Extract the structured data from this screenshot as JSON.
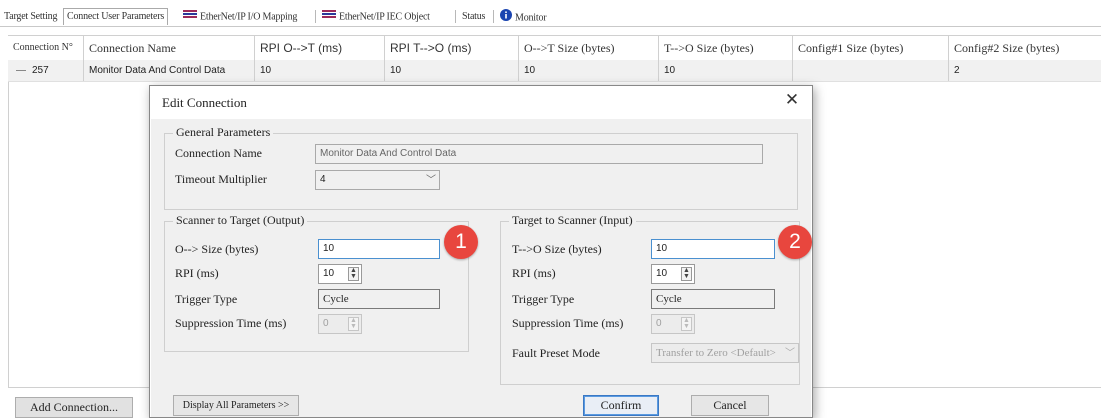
{
  "tabs": [
    {
      "label": "Target Setting",
      "icon": "",
      "active": false
    },
    {
      "label": "Connect User Parameters",
      "icon": "",
      "active": true
    },
    {
      "label": "EtherNet/IP I/O Mapping",
      "icon": "network-icon",
      "active": false
    },
    {
      "label": "EtherNet/IP IEC Object",
      "icon": "network-icon",
      "active": false
    },
    {
      "label": "Status",
      "icon": "",
      "active": false
    },
    {
      "label": "Monitor",
      "icon": "info-icon",
      "active": false
    }
  ],
  "table": {
    "columns": [
      "Connection N°",
      "Connection Name",
      "RPI O-->T (ms)",
      "RPI T-->O (ms)",
      "O-->T Size (bytes)",
      "T-->O Size (bytes)",
      "Config#1 Size (bytes)",
      "Config#2 Size (bytes)"
    ],
    "rows": [
      [
        "257",
        "Monitor Data And Control Data",
        "10",
        "10",
        "10",
        "10",
        "",
        "2"
      ]
    ]
  },
  "add_connection_label": "Add Connection...",
  "dialog": {
    "title": "Edit Connection",
    "general": {
      "legend": "General Parameters",
      "name_label": "Connection Name",
      "name_value": "Monitor Data And Control Data",
      "timeout_label": "Timeout Multiplier",
      "timeout_value": "4"
    },
    "output": {
      "legend": "Scanner to Target (Output)",
      "size_label": "O--> Size (bytes)",
      "size_value": "10",
      "rpi_label": "RPI (ms)",
      "rpi_value": "10",
      "trigger_label": "Trigger Type",
      "trigger_value": "Cycle",
      "suppression_label": "Suppression Time (ms)",
      "suppression_value": "0"
    },
    "input": {
      "legend": "Target to Scanner (Input)",
      "size_label": "T-->O Size (bytes)",
      "size_value": "10",
      "rpi_label": "RPI (ms)",
      "rpi_value": "10",
      "trigger_label": "Trigger Type",
      "trigger_value": "Cycle",
      "suppression_label": "Suppression Time (ms)",
      "suppression_value": "0",
      "fault_label": "Fault Preset Mode",
      "fault_value": "Transfer to Zero <Default>"
    },
    "display_all_label": "Display All Parameters >>",
    "confirm_label": "Confirm",
    "cancel_label": "Cancel"
  },
  "markers": [
    "1",
    "2"
  ],
  "colors": {
    "marker": "#e8463e",
    "focus_border": "#4a90d0",
    "row_highlight": "#f1f1f1"
  }
}
